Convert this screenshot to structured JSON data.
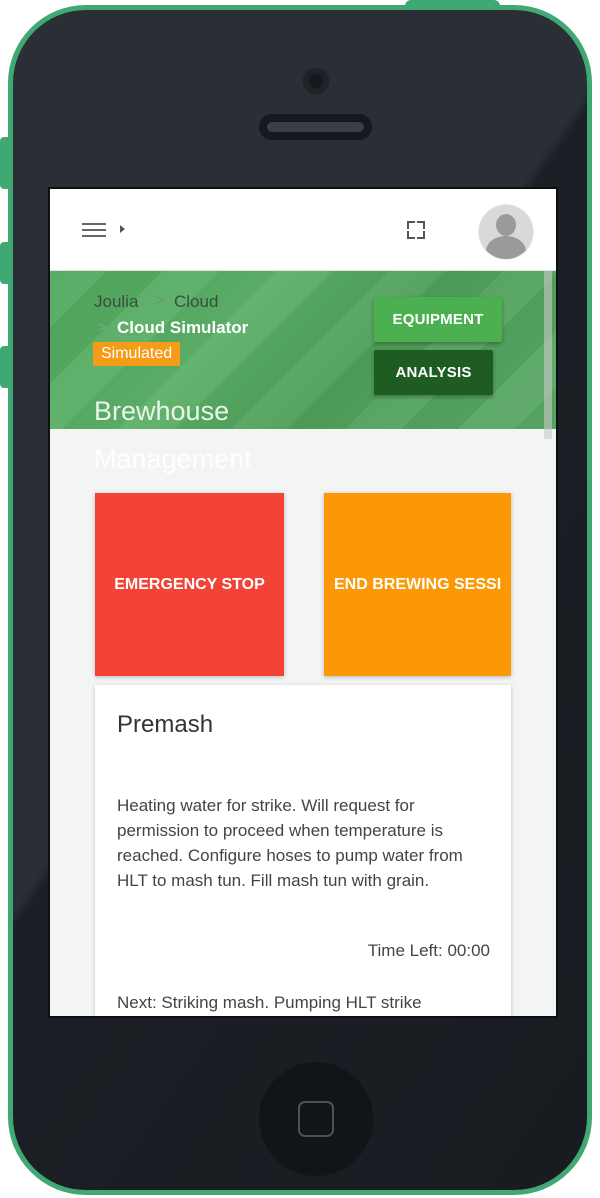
{
  "topbar": {
    "menu_icon": "hamburger-menu-icon",
    "fullscreen_icon": "fullscreen-icon",
    "avatar_icon": "user-avatar-icon"
  },
  "breadcrumb": {
    "root": "Joulia",
    "separator": ">",
    "level1": "Cloud",
    "level2": "Cloud Simulator"
  },
  "status_badge": "Simulated",
  "buttons": {
    "equipment": "EQUIPMENT",
    "analysis": "ANALYSIS"
  },
  "page_title": {
    "line1": "Brewhouse",
    "line2": "Management"
  },
  "actions": {
    "emergency_stop": "EMERGENCY STOP",
    "end_session": "END BREWING SESSI"
  },
  "step_card": {
    "title": "Premash",
    "description": "Heating water for strike. Will request for permission to proceed when temperature is reached. Configure hoses to pump water from HLT to mash tun. Fill mash tun with grain.",
    "time_left": "Time Left: 00:00",
    "next": "Next: Striking mash. Pumping HLT strike"
  },
  "colors": {
    "frame": "#3fa873",
    "hero_green": "#4fa85d",
    "equipment_button": "#4caf50",
    "analysis_button": "#1f5c22",
    "badge": "#f59b17",
    "emergency_stop": "#f24336",
    "end_session": "#fc9806"
  }
}
